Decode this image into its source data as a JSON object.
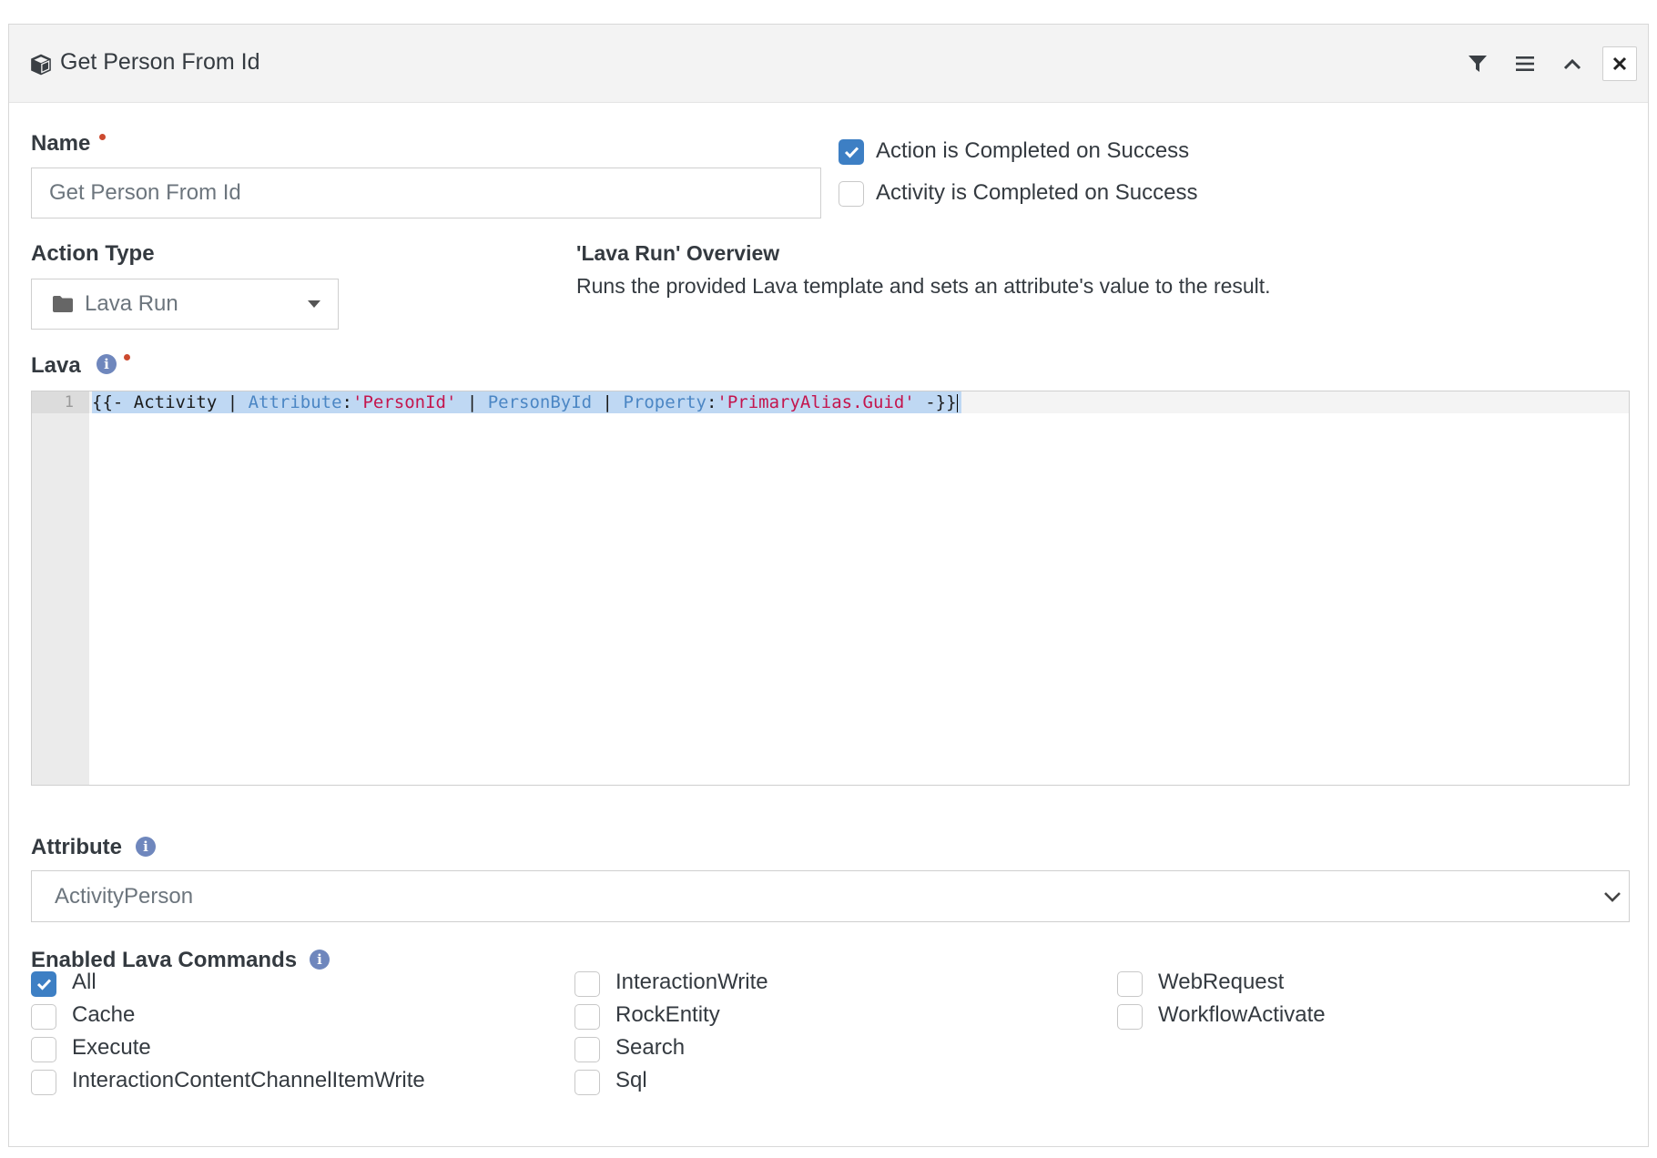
{
  "panel": {
    "title": "Get Person From Id",
    "icons": [
      "cube-icon",
      "filter-icon",
      "menu-icon",
      "chevron-up-icon",
      "close-icon"
    ]
  },
  "name_field": {
    "label": "Name",
    "value": "Get Person From Id",
    "required": true
  },
  "completion": {
    "action_completed": {
      "label": "Action is Completed on Success",
      "checked": true
    },
    "activity_completed": {
      "label": "Activity is Completed on Success",
      "checked": false
    }
  },
  "action_type": {
    "label": "Action Type",
    "value": "Lava Run",
    "icon": "folder-icon"
  },
  "overview": {
    "title": "'Lava Run' Overview",
    "description": "Runs the provided Lava template and sets an attribute's value to the result."
  },
  "lava": {
    "label": "Lava",
    "required": true,
    "line_number": "1",
    "code_tokens": [
      {
        "text": "{{- Activity | ",
        "kind": "plain"
      },
      {
        "text": "Attribute",
        "kind": "filter"
      },
      {
        "text": ":",
        "kind": "plain"
      },
      {
        "text": "'PersonId'",
        "kind": "str"
      },
      {
        "text": " | ",
        "kind": "plain"
      },
      {
        "text": "PersonById",
        "kind": "filter"
      },
      {
        "text": " | ",
        "kind": "plain"
      },
      {
        "text": "Property",
        "kind": "filter"
      },
      {
        "text": ":",
        "kind": "plain"
      },
      {
        "text": "'PrimaryAlias.Guid'",
        "kind": "str"
      },
      {
        "text": " -}}",
        "kind": "plain"
      }
    ]
  },
  "attribute": {
    "label": "Attribute",
    "value": "ActivityPerson"
  },
  "commands": {
    "label": "Enabled Lava Commands",
    "items": [
      {
        "label": "All",
        "checked": true
      },
      {
        "label": "Cache",
        "checked": false
      },
      {
        "label": "Execute",
        "checked": false
      },
      {
        "label": "InteractionContentChannelItemWrite",
        "checked": false
      },
      {
        "label": "InteractionWrite",
        "checked": false
      },
      {
        "label": "RockEntity",
        "checked": false
      },
      {
        "label": "Search",
        "checked": false
      },
      {
        "label": "Sql",
        "checked": false
      },
      {
        "label": "WebRequest",
        "checked": false
      },
      {
        "label": "WorkflowActivate",
        "checked": false
      }
    ]
  },
  "colors": {
    "accent": "#3d7fc4",
    "required": "#cc4a2f",
    "info": "#6f87bd"
  }
}
